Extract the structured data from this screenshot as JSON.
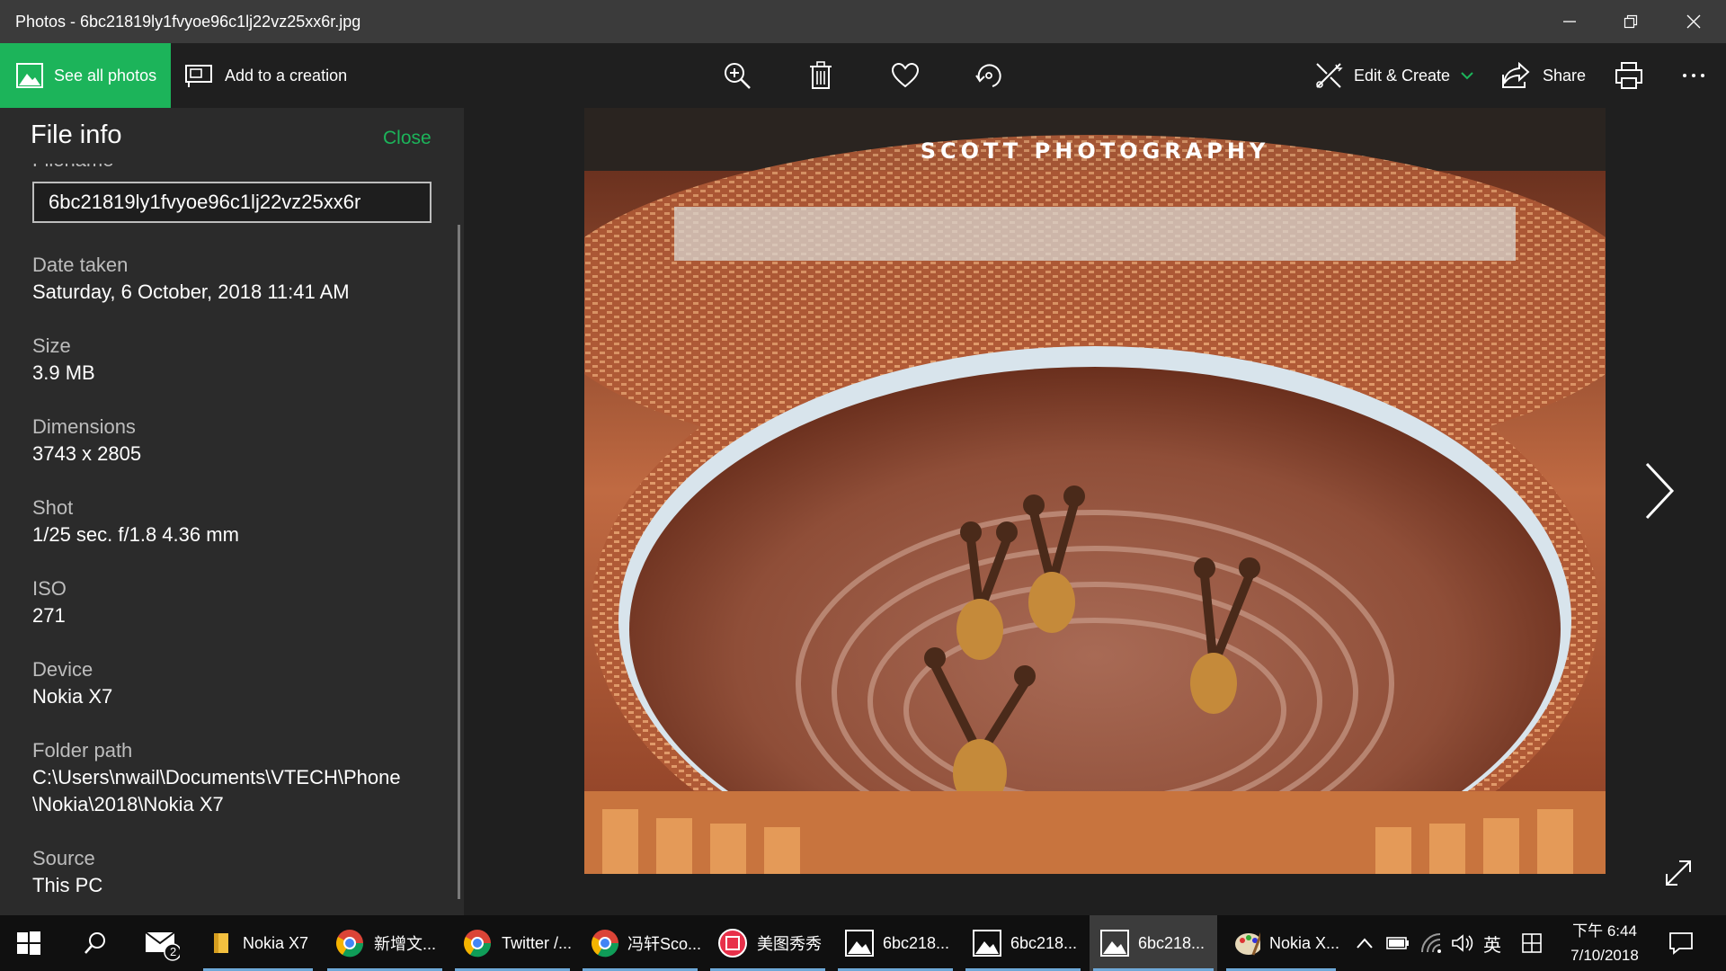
{
  "window": {
    "title": "Photos - 6bc21819ly1fvyoe96c1lj22vz25xx6r.jpg"
  },
  "toolbar": {
    "see_all_label": "See all photos",
    "add_creation_label": "Add to a creation",
    "edit_create_label": "Edit & Create",
    "share_label": "Share"
  },
  "panel": {
    "title": "File info",
    "close_label": "Close",
    "filename_label": "Filename",
    "filename_value": "6bc21819ly1fvyoe96c1lj22vz25xx6r",
    "items": [
      {
        "label": "Date taken",
        "value": "Saturday, 6 October, 2018 11:41 AM"
      },
      {
        "label": "Size",
        "value": "3.9 MB"
      },
      {
        "label": "Dimensions",
        "value": "3743 x 2805"
      },
      {
        "label": "Shot",
        "value": "1/25 sec. f/1.8 4.36 mm"
      },
      {
        "label": "ISO",
        "value": "271"
      },
      {
        "label": "Device",
        "value": "Nokia X7"
      },
      {
        "label": "Folder path",
        "value": "C:\\Users\\nwail\\Documents\\VTECH\\Phone",
        "value2": "\\Nokia\\2018\\Nokia X7"
      },
      {
        "label": "Source",
        "value": "This PC"
      }
    ]
  },
  "photo": {
    "watermark": "SCOTT PHOTOGRAPHY"
  },
  "taskbar": {
    "mail_badge": "2",
    "apps": [
      {
        "label": "Nokia X7"
      },
      {
        "label": "新增文..."
      },
      {
        "label": "Twitter /..."
      },
      {
        "label": "冯轩Sco..."
      },
      {
        "label": "美图秀秀"
      },
      {
        "label": "6bc218..."
      },
      {
        "label": "6bc218..."
      },
      {
        "label": "6bc218..."
      },
      {
        "label": "Nokia X..."
      }
    ],
    "ime_label": "英",
    "clock_time": "下午 6:44",
    "clock_date": "7/10/2018"
  },
  "colors": {
    "accent": "#1cb45a",
    "titlebar": "#3b3b3b",
    "panel": "#2b2b2b",
    "background": "#1f1f1f",
    "taskbar": "#101010"
  }
}
